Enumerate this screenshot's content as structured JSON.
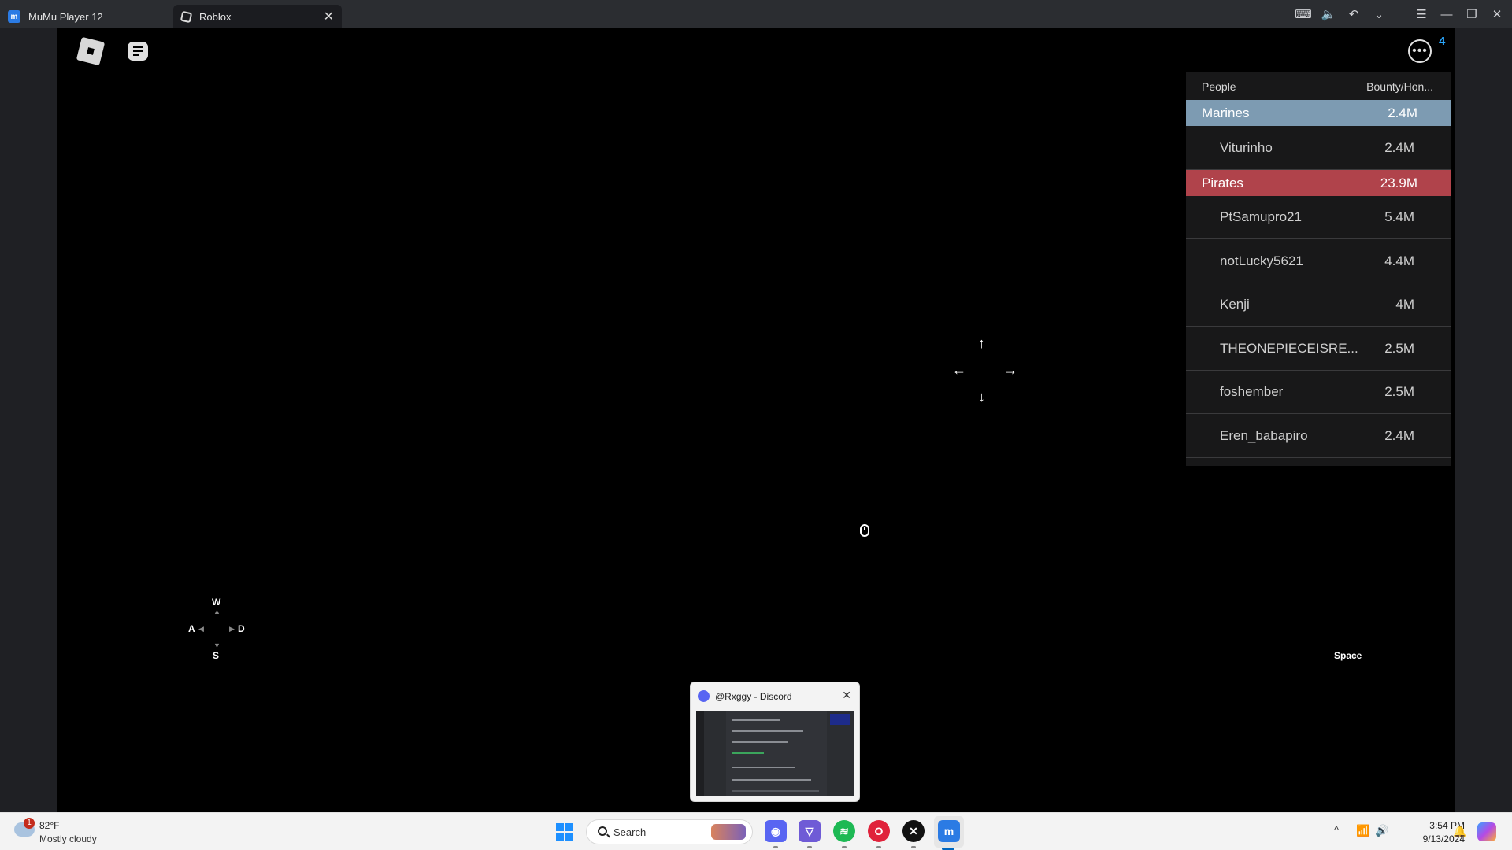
{
  "window": {
    "tabs": [
      {
        "label": "MuMu Player 12",
        "icon": "mumu-icon"
      },
      {
        "label": "Roblox",
        "icon": "roblox-icon"
      }
    ],
    "close_glyph": "✕"
  },
  "game": {
    "more_badge": "4",
    "leaderboard": {
      "col_people": "People",
      "col_bounty": "Bounty/Hon...",
      "teams": [
        {
          "name": "Marines",
          "value": "2.4M",
          "color": "#7d9bb2",
          "players": [
            {
              "name": "Viturinho",
              "value": "2.4M"
            }
          ]
        },
        {
          "name": "Pirates",
          "value": "23.9M",
          "color": "#b0434b",
          "players": [
            {
              "name": "PtSamupro21",
              "value": "5.4M"
            },
            {
              "name": "notLucky5621",
              "value": "4.4M"
            },
            {
              "name": "Kenji",
              "value": "4M"
            },
            {
              "name": "THEONEPIECEISRE...",
              "value": "2.5M"
            },
            {
              "name": "foshember",
              "value": "2.5M"
            },
            {
              "name": "Eren_babapiro",
              "value": "2.4M"
            }
          ]
        }
      ]
    },
    "arrows": {
      "up": "↑",
      "down": "↓",
      "left": "←",
      "right": "→"
    },
    "keys": {
      "w": "W",
      "a": "A",
      "s": "S",
      "d": "D",
      "space": "Space"
    }
  },
  "discord_preview": {
    "title": "@Rxggy - Discord",
    "close_glyph": "✕"
  },
  "taskbar": {
    "weather": {
      "temp": "82°F",
      "desc": "Mostly cloudy",
      "badge": "1"
    },
    "search_placeholder": "Search",
    "clock": {
      "time": "3:54 PM",
      "date": "9/13/2024"
    },
    "tray": {
      "chevron": "^",
      "wifi": "wifi-icon",
      "volume": "volume-icon"
    }
  }
}
